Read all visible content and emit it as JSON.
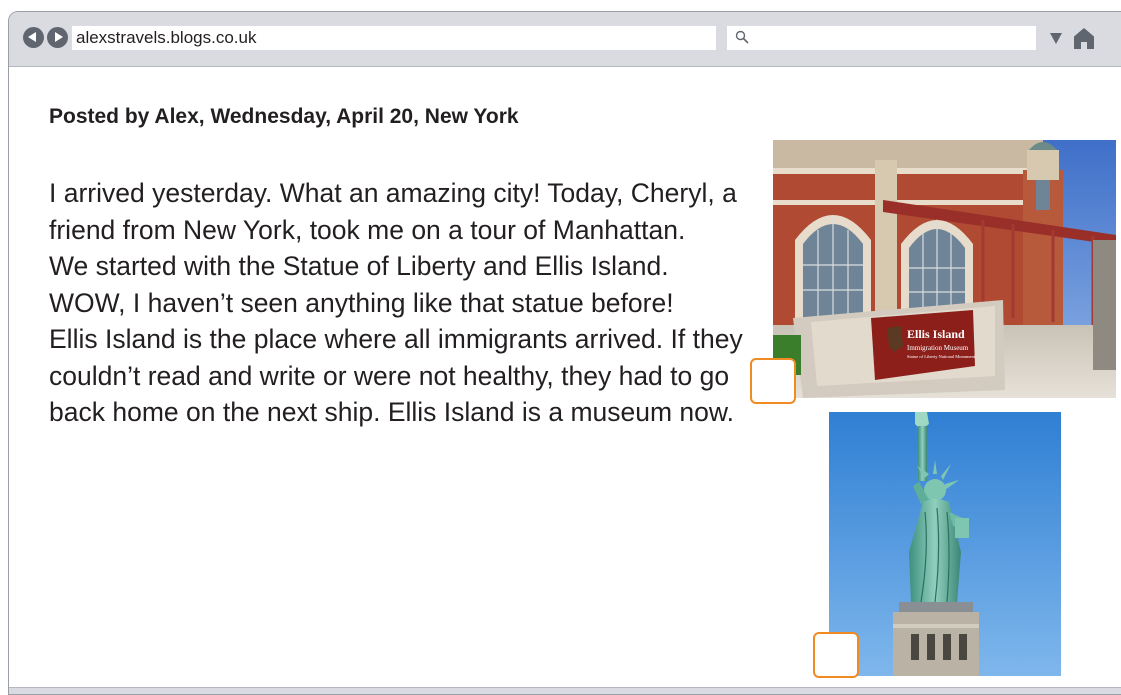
{
  "browser": {
    "url": "alexstravels.blogs.co.uk",
    "search_value": ""
  },
  "icons": {
    "back": "back-arrow-icon",
    "forward": "forward-arrow-icon",
    "search": "search-icon",
    "dropdown": "dropdown-icon",
    "home": "home-icon"
  },
  "post": {
    "meta": "Posted by Alex, Wednesday, April 20, New York",
    "paragraphs": [
      "I arrived yesterday. What an amazing city! Today, Cheryl, a friend from New York, took me on a tour of Manhattan.",
      "We started with the Statue of Liberty and Ellis Island. WOW, I haven’t seen anything like that statue before!",
      "Ellis Island is the place where all immigrants arrived. If they couldn’t read and write or were not healthy, they had to go back home on the next ship. Ellis Island is a museum now."
    ]
  },
  "photos": {
    "ellis": {
      "sign_title": "Ellis Island",
      "sign_line2": "Immigration Museum",
      "sign_line3": "Statue of Liberty National Monument"
    }
  },
  "colors": {
    "toolbar": "#d9dbe0",
    "nav_button": "#5f6670",
    "answer_box_border": "#f08a22",
    "text": "#231f20"
  }
}
